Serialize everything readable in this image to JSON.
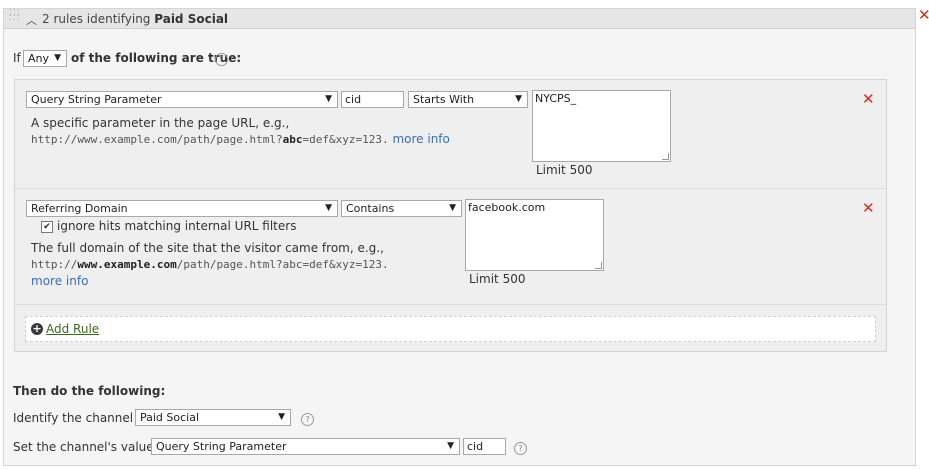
{
  "header": {
    "title_prefix": "2 rules identifying",
    "title_channel": "Paid Social"
  },
  "condition": {
    "if_label": "If",
    "match_value": "Any",
    "suffix": "of the following are true:",
    "help": "?"
  },
  "rules": [
    {
      "type": "Query String Parameter",
      "param": "cid",
      "operator": "Starts With",
      "value": "NYCPS_",
      "description": "A specific parameter in the page URL, e.g.,",
      "example_pre": "http://www.example.com/path/page.html?",
      "example_bold": "abc",
      "example_post": "=def&xyz=123.",
      "more_info": "more info",
      "limit": "Limit 500"
    },
    {
      "type": "Referring Domain",
      "operator": "Contains",
      "value": "facebook.com",
      "checkbox_label": "ignore hits matching internal URL filters",
      "checkbox_checked": true,
      "description": "The full domain of the site that the visitor came from, e.g.,",
      "example_pre": "http://",
      "example_bold": "www.example.com",
      "example_post": "/path/page.html?abc=def&xyz=123.",
      "more_info": "more info",
      "limit": "Limit 500"
    }
  ],
  "add_rule": {
    "label": "Add Rule"
  },
  "then": {
    "title": "Then do the following:",
    "identify_label": "Identify the channel as",
    "identify_value": "Paid Social",
    "set_label": "Set the channel's value to",
    "set_type": "Query String Parameter",
    "set_param": "cid",
    "help": "?"
  },
  "icons": {
    "close": "close-icon",
    "add": "plus-circle-icon",
    "collapse": "chevron-up-icon",
    "drag": "drag-handle-icon"
  },
  "colors": {
    "close_red": "#d52b1e",
    "link_blue": "#3b6cb5",
    "add_green": "#3c6a1d"
  }
}
